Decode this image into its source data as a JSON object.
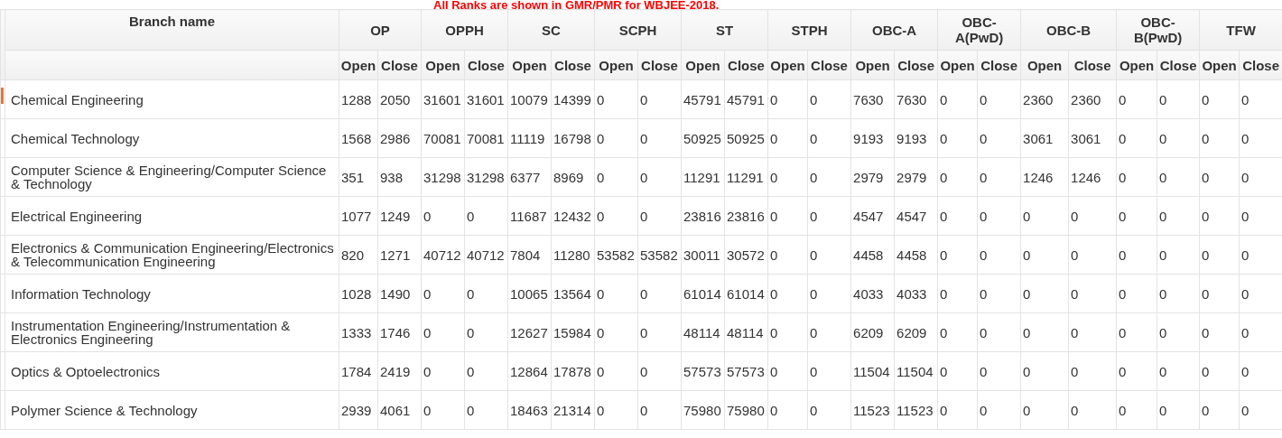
{
  "notice": "All Ranks are shown in GMR/PMR for WBJEE-2018.",
  "table": {
    "branch_header": "Branch name",
    "groups": [
      {
        "label": "OP",
        "sub": [
          "Open",
          "Close"
        ]
      },
      {
        "label": "OPPH",
        "sub": [
          "Open",
          "Close"
        ]
      },
      {
        "label": "SC",
        "sub": [
          "Open",
          "Close"
        ]
      },
      {
        "label": "SCPH",
        "sub": [
          "Open",
          "Close"
        ]
      },
      {
        "label": "ST",
        "sub": [
          "Open",
          "Close"
        ]
      },
      {
        "label": "STPH",
        "sub": [
          "Open",
          "Close"
        ]
      },
      {
        "label": "OBC-A",
        "sub": [
          "Open",
          "Close"
        ]
      },
      {
        "label": "OBC-A(PwD)",
        "sub": [
          "Open",
          "Close"
        ]
      },
      {
        "label": "OBC-B",
        "sub": [
          "Open",
          "Close"
        ]
      },
      {
        "label": "OBC-B(PwD)",
        "sub": [
          "Open",
          "Close"
        ]
      },
      {
        "label": "TFW",
        "sub": [
          "Open",
          "Close"
        ]
      }
    ],
    "rows": [
      {
        "branch": "Chemical Engineering",
        "marked": true,
        "values": [
          "1288",
          "2050",
          "31601",
          "31601",
          "10079",
          "14399",
          "0",
          "0",
          "45791",
          "45791",
          "0",
          "0",
          "7630",
          "7630",
          "0",
          "0",
          "2360",
          "2360",
          "0",
          "0",
          "0",
          "0"
        ]
      },
      {
        "branch": "Chemical Technology",
        "marked": false,
        "values": [
          "1568",
          "2986",
          "70081",
          "70081",
          "11119",
          "16798",
          "0",
          "0",
          "50925",
          "50925",
          "0",
          "0",
          "9193",
          "9193",
          "0",
          "0",
          "3061",
          "3061",
          "0",
          "0",
          "0",
          "0"
        ]
      },
      {
        "branch": "Computer Science & Engineering/Computer Science & Technology",
        "marked": false,
        "values": [
          "351",
          "938",
          "31298",
          "31298",
          "6377",
          "8969",
          "0",
          "0",
          "11291",
          "11291",
          "0",
          "0",
          "2979",
          "2979",
          "0",
          "0",
          "1246",
          "1246",
          "0",
          "0",
          "0",
          "0"
        ]
      },
      {
        "branch": "Electrical Engineering",
        "marked": false,
        "values": [
          "1077",
          "1249",
          "0",
          "0",
          "11687",
          "12432",
          "0",
          "0",
          "23816",
          "23816",
          "0",
          "0",
          "4547",
          "4547",
          "0",
          "0",
          "0",
          "0",
          "0",
          "0",
          "0",
          "0"
        ]
      },
      {
        "branch": "Electronics & Communication Engineering/Electronics & Telecommunication Engineering",
        "marked": false,
        "values": [
          "820",
          "1271",
          "40712",
          "40712",
          "7804",
          "11280",
          "53582",
          "53582",
          "30011",
          "30572",
          "0",
          "0",
          "4458",
          "4458",
          "0",
          "0",
          "0",
          "0",
          "0",
          "0",
          "0",
          "0"
        ]
      },
      {
        "branch": "Information Technology",
        "marked": false,
        "values": [
          "1028",
          "1490",
          "0",
          "0",
          "10065",
          "13564",
          "0",
          "0",
          "61014",
          "61014",
          "0",
          "0",
          "4033",
          "4033",
          "0",
          "0",
          "0",
          "0",
          "0",
          "0",
          "0",
          "0"
        ]
      },
      {
        "branch": "Instrumentation Engineering/Instrumentation & Electronics Engineering",
        "marked": false,
        "values": [
          "1333",
          "1746",
          "0",
          "0",
          "12627",
          "15984",
          "0",
          "0",
          "48114",
          "48114",
          "0",
          "0",
          "6209",
          "6209",
          "0",
          "0",
          "0",
          "0",
          "0",
          "0",
          "0",
          "0"
        ]
      },
      {
        "branch": "Optics & Optoelectronics",
        "marked": false,
        "values": [
          "1784",
          "2419",
          "0",
          "0",
          "12864",
          "17878",
          "0",
          "0",
          "57573",
          "57573",
          "0",
          "0",
          "11504",
          "11504",
          "0",
          "0",
          "0",
          "0",
          "0",
          "0",
          "0",
          "0"
        ]
      },
      {
        "branch": "Polymer Science & Technology",
        "marked": false,
        "values": [
          "2939",
          "4061",
          "0",
          "0",
          "18463",
          "21314",
          "0",
          "0",
          "75980",
          "75980",
          "0",
          "0",
          "11523",
          "11523",
          "0",
          "0",
          "0",
          "0",
          "0",
          "0",
          "0",
          "0"
        ]
      }
    ]
  }
}
